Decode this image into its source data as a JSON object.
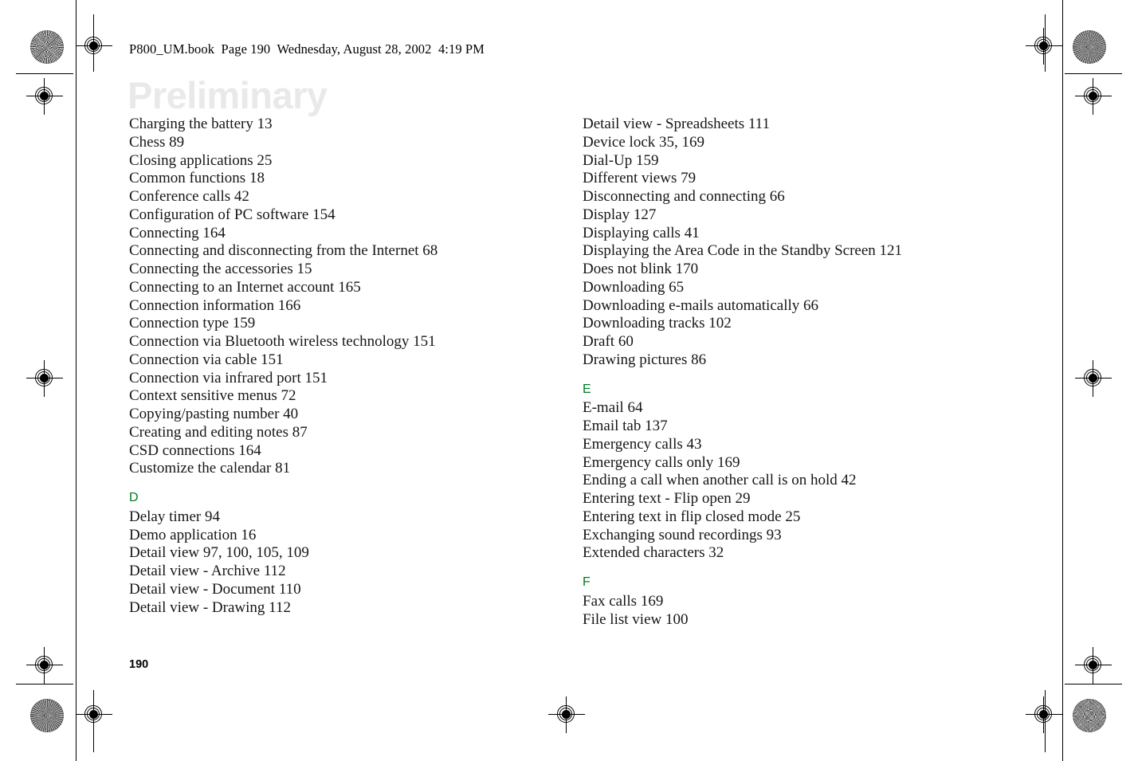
{
  "document": {
    "header_slug": "P800_UM.book  Page 190  Wednesday, August 28, 2002  4:19 PM",
    "watermark": "Preliminary",
    "page_number": "190",
    "section_letter_color": "#007c23",
    "watermark_color": "#e9e9e9"
  },
  "index": {
    "left_column": [
      {
        "type": "entry",
        "text": "Charging the battery 13"
      },
      {
        "type": "entry",
        "text": "Chess 89"
      },
      {
        "type": "entry",
        "text": "Closing applications 25"
      },
      {
        "type": "entry",
        "text": "Common functions 18"
      },
      {
        "type": "entry",
        "text": "Conference calls 42"
      },
      {
        "type": "entry",
        "text": "Configuration of PC software 154"
      },
      {
        "type": "entry",
        "text": "Connecting 164"
      },
      {
        "type": "entry",
        "text": "Connecting and disconnecting from the Internet 68"
      },
      {
        "type": "entry",
        "text": "Connecting the accessories 15"
      },
      {
        "type": "entry",
        "text": "Connecting to an Internet account 165"
      },
      {
        "type": "entry",
        "text": "Connection information 166"
      },
      {
        "type": "entry",
        "text": "Connection type 159"
      },
      {
        "type": "entry",
        "text": "Connection via Bluetooth wireless technology 151"
      },
      {
        "type": "entry",
        "text": "Connection via cable 151"
      },
      {
        "type": "entry",
        "text": "Connection via infrared port 151"
      },
      {
        "type": "entry",
        "text": "Context sensitive menus 72"
      },
      {
        "type": "entry",
        "text": "Copying/pasting number 40"
      },
      {
        "type": "entry",
        "text": "Creating and editing notes 87"
      },
      {
        "type": "entry",
        "text": "CSD connections 164"
      },
      {
        "type": "entry",
        "text": "Customize the calendar 81"
      },
      {
        "type": "letter",
        "text": "D"
      },
      {
        "type": "entry",
        "text": "Delay timer 94"
      },
      {
        "type": "entry",
        "text": "Demo application 16"
      },
      {
        "type": "entry",
        "text": "Detail view 97, 100, 105, 109"
      },
      {
        "type": "entry",
        "text": "Detail view - Archive 112"
      },
      {
        "type": "entry",
        "text": "Detail view - Document 110"
      },
      {
        "type": "entry",
        "text": "Detail view - Drawing 112"
      }
    ],
    "right_column": [
      {
        "type": "entry",
        "text": "Detail view - Spreadsheets 111"
      },
      {
        "type": "entry",
        "text": "Device lock 35, 169"
      },
      {
        "type": "entry",
        "text": "Dial-Up 159"
      },
      {
        "type": "entry",
        "text": "Different views 79"
      },
      {
        "type": "entry",
        "text": "Disconnecting and connecting 66"
      },
      {
        "type": "entry",
        "text": "Display 127"
      },
      {
        "type": "entry",
        "text": "Displaying calls 41"
      },
      {
        "type": "entry",
        "text": "Displaying the Area Code in the Standby Screen 121"
      },
      {
        "type": "entry",
        "text": "Does not blink 170"
      },
      {
        "type": "entry",
        "text": "Downloading 65"
      },
      {
        "type": "entry",
        "text": "Downloading e-mails automatically 66"
      },
      {
        "type": "entry",
        "text": "Downloading tracks 102"
      },
      {
        "type": "entry",
        "text": "Draft 60"
      },
      {
        "type": "entry",
        "text": "Drawing pictures 86"
      },
      {
        "type": "letter",
        "text": "E"
      },
      {
        "type": "entry",
        "text": "E-mail 64"
      },
      {
        "type": "entry",
        "text": "Email tab 137"
      },
      {
        "type": "entry",
        "text": "Emergency calls 43"
      },
      {
        "type": "entry",
        "text": "Emergency calls only 169"
      },
      {
        "type": "entry",
        "text": "Ending a call when another call is on hold 42"
      },
      {
        "type": "entry",
        "text": "Entering text - Flip open 29"
      },
      {
        "type": "entry",
        "text": "Entering text in flip closed mode 25"
      },
      {
        "type": "entry",
        "text": "Exchanging sound recordings 93"
      },
      {
        "type": "entry",
        "text": "Extended characters 32"
      },
      {
        "type": "letter",
        "text": "F"
      },
      {
        "type": "entry",
        "text": "Fax calls 169"
      },
      {
        "type": "entry",
        "text": "File list view 100"
      }
    ]
  }
}
